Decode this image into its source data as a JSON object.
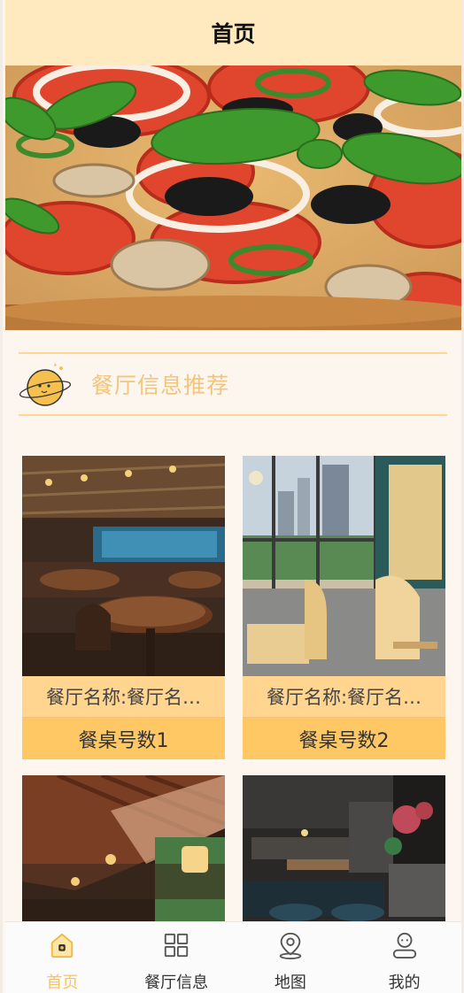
{
  "header": {
    "title": "首页"
  },
  "section": {
    "title": "餐厅信息推荐",
    "icon": "planet-mascot-icon"
  },
  "restaurants": [
    {
      "name": "餐厅名称:餐厅名…",
      "table": "餐桌号数1"
    },
    {
      "name": "餐厅名称:餐厅名…",
      "table": "餐桌号数2"
    },
    {
      "name": "",
      "table": ""
    },
    {
      "name": "",
      "table": ""
    }
  ],
  "tabbar": {
    "items": [
      {
        "label": "首页",
        "icon": "home-icon",
        "active": true
      },
      {
        "label": "餐厅信息",
        "icon": "grid-icon",
        "active": false
      },
      {
        "label": "地图",
        "icon": "map-pin-icon",
        "active": false
      },
      {
        "label": "我的",
        "icon": "user-icon",
        "active": false
      }
    ]
  },
  "colors": {
    "header_bg": "#ffe9bf",
    "accent": "#f4c36b",
    "card_bg": "#ffc864"
  }
}
